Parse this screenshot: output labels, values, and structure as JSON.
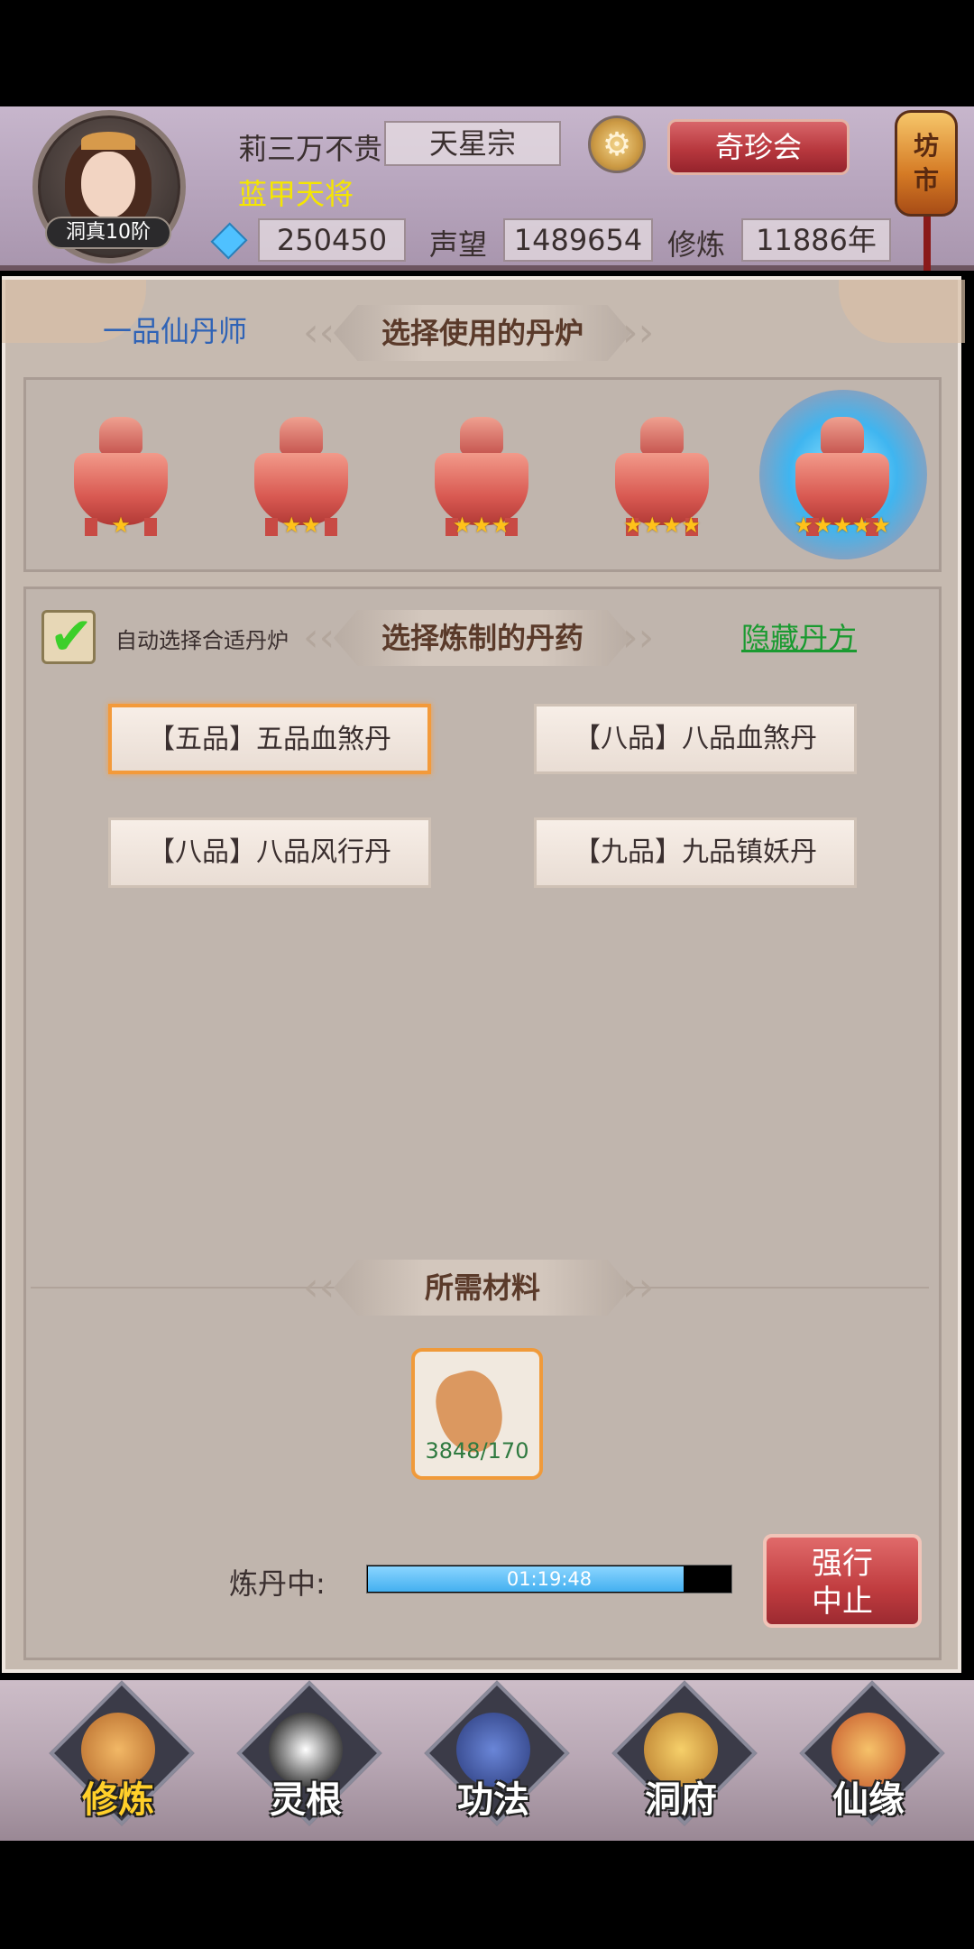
{
  "header": {
    "avatar_rank": "洞真10阶",
    "player_name": "莉三万不贵",
    "sect": "天星宗",
    "title": "蓝甲天将",
    "spirit_stones": "250450",
    "reputation_label": "声望",
    "reputation": "1489654",
    "cultivation_label": "修炼",
    "cultivation": "11886年",
    "treasure_button": "奇珍会",
    "market_button": "坊 市"
  },
  "panel": {
    "rank_title": "一品仙丹师",
    "furnace_section_title": "选择使用的丹炉",
    "furnaces": [
      {
        "stars": "★"
      },
      {
        "stars": "★★"
      },
      {
        "stars": "★★★"
      },
      {
        "stars": "★★★★"
      },
      {
        "stars": "★★★★★"
      }
    ],
    "selected_furnace": 5,
    "auto_select_label": "自动选择合适丹炉",
    "auto_select_checked": "✔",
    "pill_section_title": "选择炼制的丹药",
    "hide_recipe_link": "隐藏丹方",
    "recipes": [
      {
        "label": "【五品】五品血煞丹",
        "selected": true
      },
      {
        "label": "【八品】八品血煞丹",
        "selected": false
      },
      {
        "label": "【八品】八品风行丹",
        "selected": false
      },
      {
        "label": "【九品】九品镇妖丹",
        "selected": false
      }
    ],
    "materials_section_title": "所需材料",
    "material_count": "3848/170",
    "refining_label": "炼丹中:",
    "refining_time": "01:19:48",
    "refining_progress": 0.87,
    "force_stop_line1": "强行",
    "force_stop_line2": "中止"
  },
  "nav": {
    "items": [
      {
        "label": "修炼",
        "active": true
      },
      {
        "label": "灵根",
        "active": false
      },
      {
        "label": "功法",
        "active": false
      },
      {
        "label": "洞府",
        "active": false
      },
      {
        "label": "仙缘",
        "active": false
      }
    ]
  },
  "colors": {
    "accent_orange": "#f39a3a",
    "rank_blue": "#2f63b6",
    "link_green": "#1a9a30",
    "title_yellow": "#f5e600",
    "star_gold": "#ffc21a"
  }
}
